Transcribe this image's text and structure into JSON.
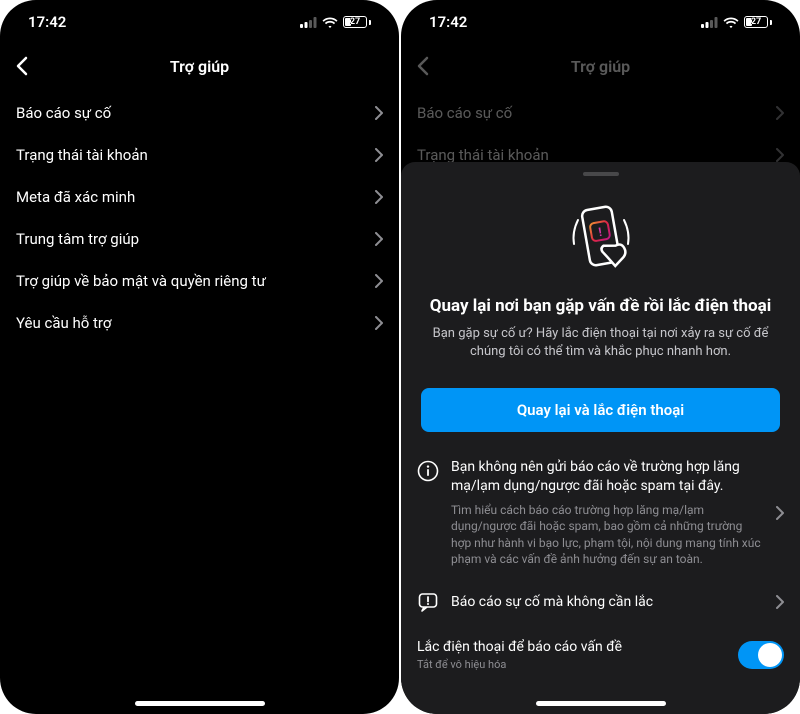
{
  "status": {
    "time": "17:42",
    "battery": "27"
  },
  "left": {
    "title": "Trợ giúp",
    "rows": [
      "Báo cáo sự cố",
      "Trạng thái tài khoản",
      "Meta đã xác minh",
      "Trung tâm trợ giúp",
      "Trợ giúp về bảo mật và quyền riêng tư",
      "Yêu cầu hỗ trợ"
    ]
  },
  "right": {
    "title": "Trợ giúp",
    "dimmed_rows": [
      "Báo cáo sự cố",
      "Trạng thái tài khoản"
    ],
    "sheet": {
      "hero_title": "Quay lại nơi bạn gặp vấn đề rồi lắc điện thoại",
      "hero_desc": "Bạn gặp sự cố ư? Hãy lắc điện thoại tại nơi xảy ra sự cố để chúng tôi có thể tìm và khắc phục nhanh hơn.",
      "primary_btn": "Quay lại và lắc điện thoại",
      "info_title": "Bạn không nên gửi báo cáo về trường hợp lăng mạ/lạm dụng/ngược đãi hoặc spam tại đây.",
      "info_sub": "Tìm hiểu cách báo cáo trường hợp lăng mạ/lạm dụng/ngược đãi hoặc spam, bao gồm cả những trường hợp như hành vi bạo lực, phạm tội, nội dung mang tính xúc phạm và các vấn đề ảnh hưởng đến sự an toàn.",
      "report_label": "Báo cáo sự cố mà không cần lắc",
      "toggle_label": "Lắc điện thoại để báo cáo vấn đề",
      "toggle_sub": "Tắt để vô hiệu hóa"
    }
  }
}
